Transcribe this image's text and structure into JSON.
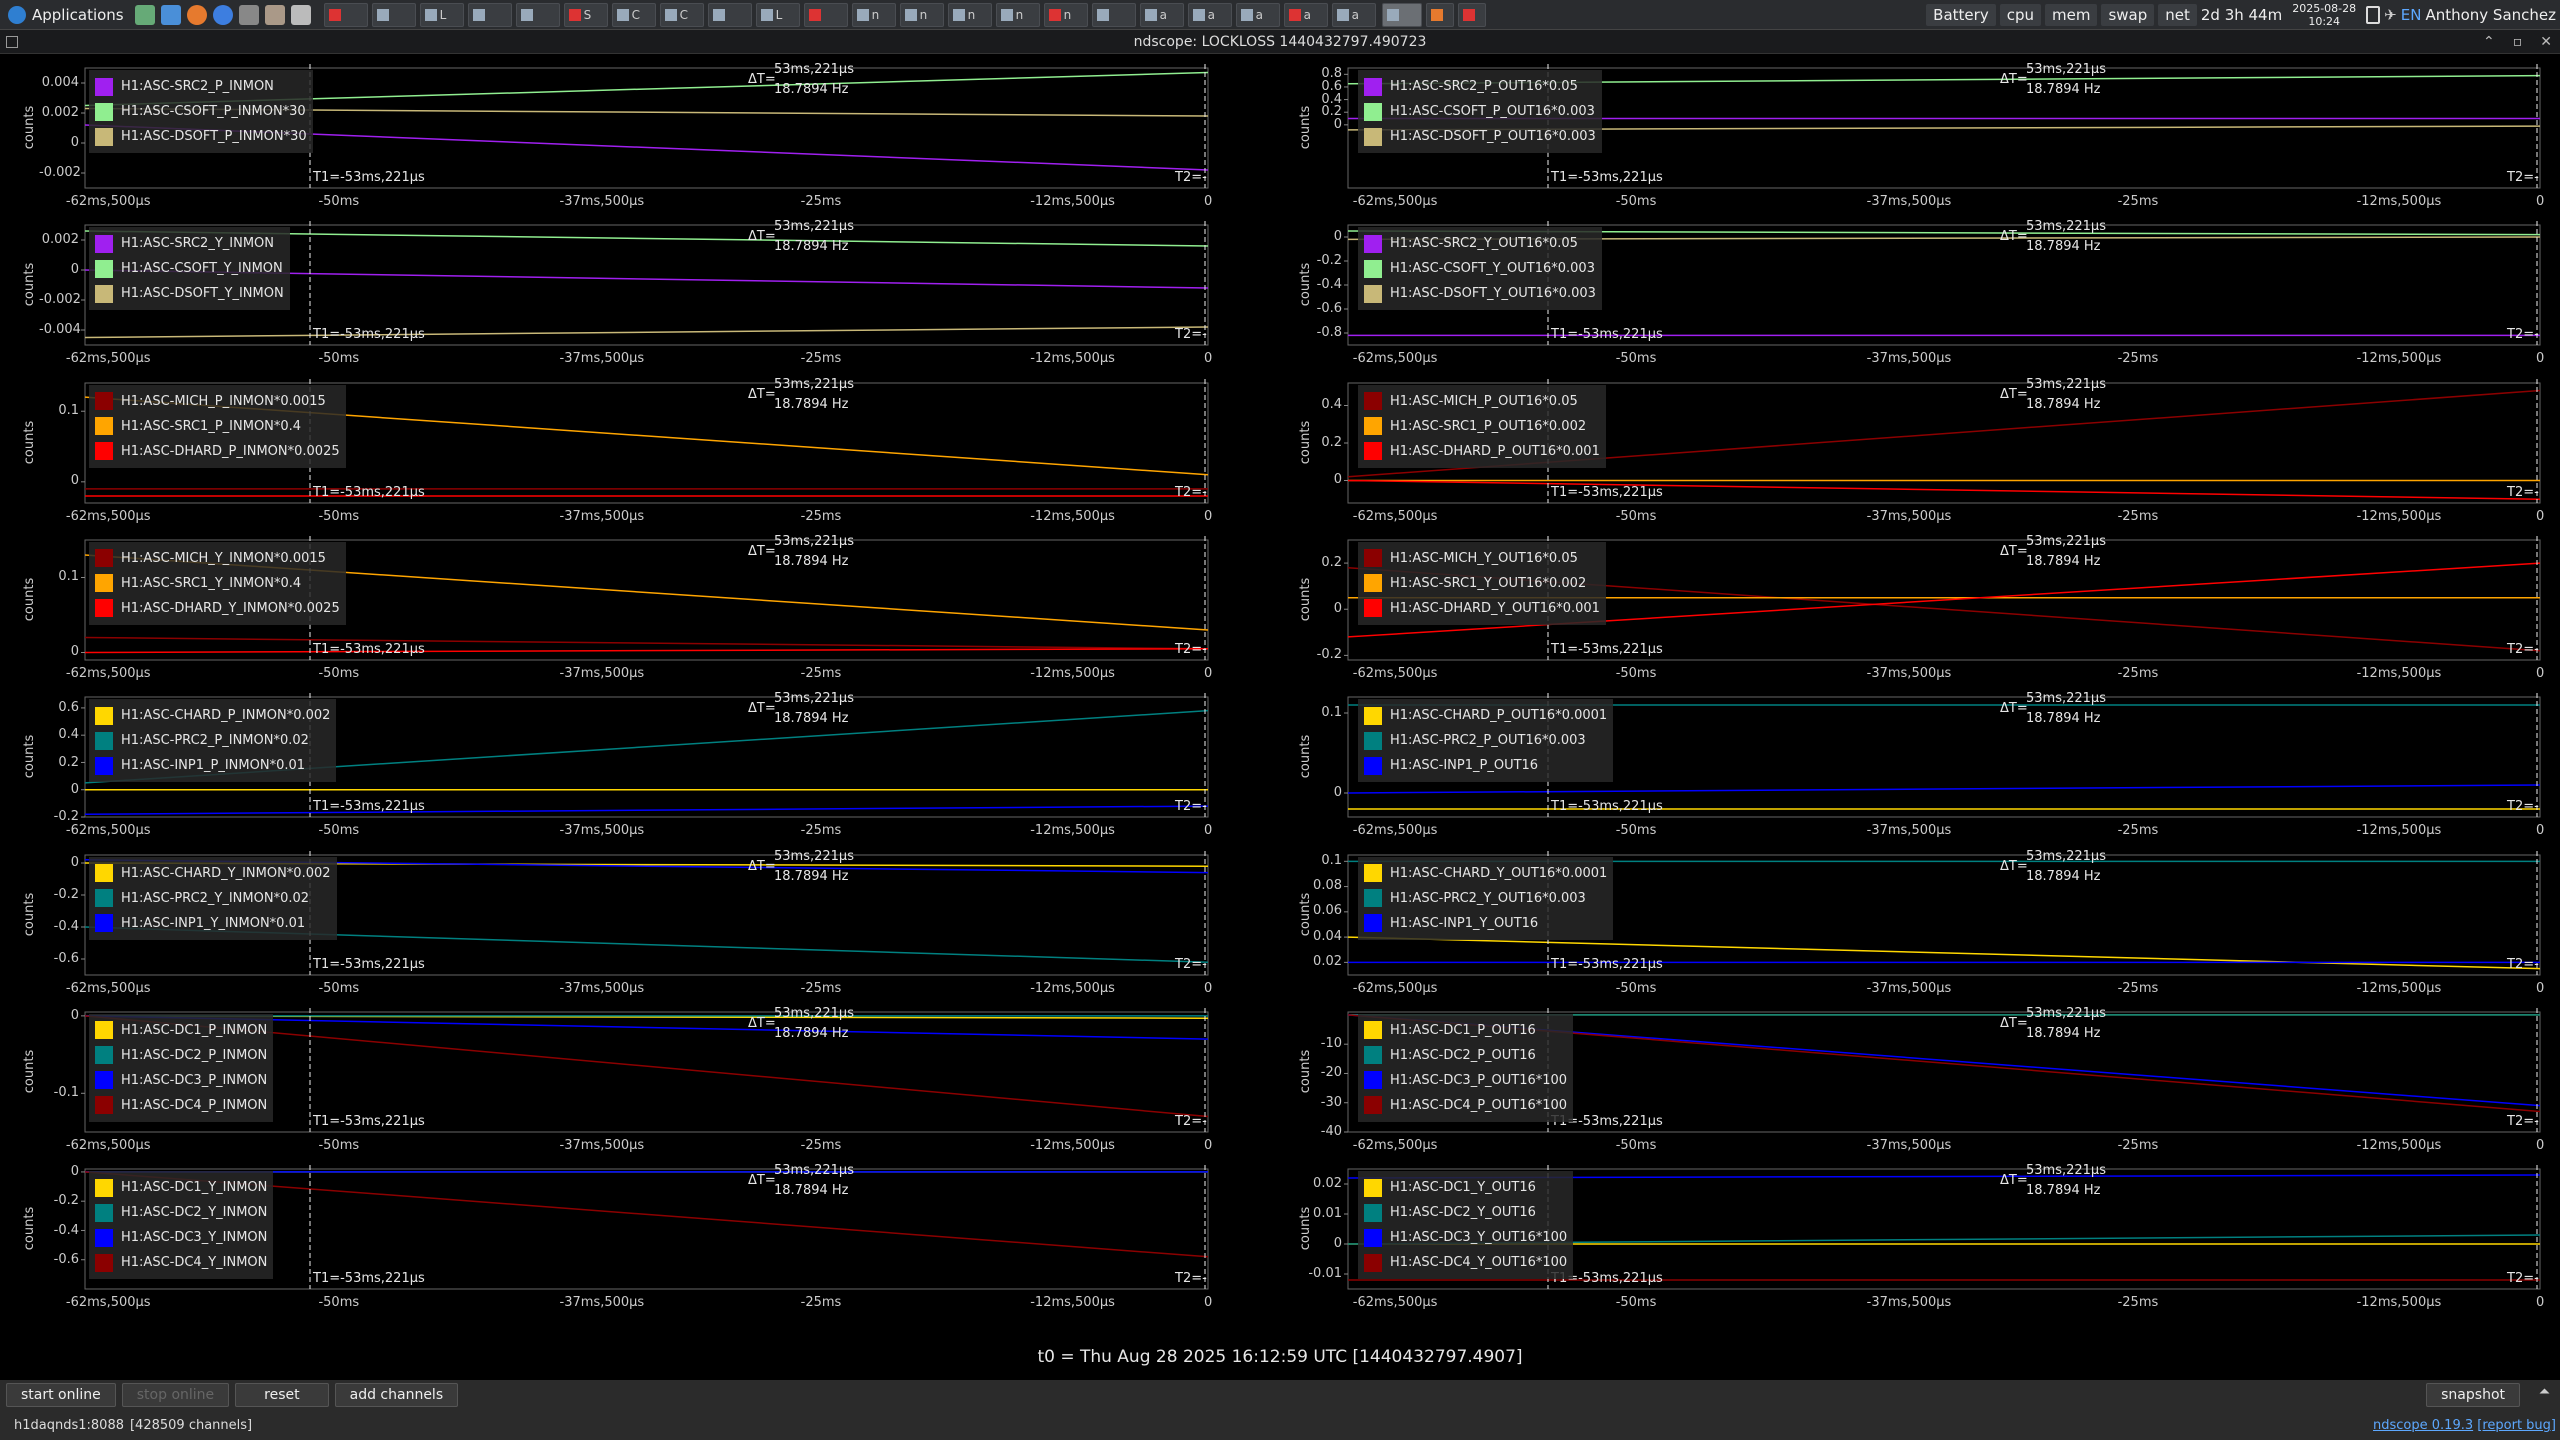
{
  "taskbar": {
    "apps_label": "Applications",
    "tasks": [
      "",
      "",
      "L",
      "",
      "",
      "S",
      "C",
      "C",
      "",
      "L",
      "",
      "n",
      "n",
      "n",
      "n",
      "n",
      "",
      "a",
      "a",
      "a",
      "a",
      "a"
    ],
    "tray": {
      "battery": "Battery",
      "cpu": "cpu",
      "mem": "mem",
      "swap": "swap",
      "net": "net",
      "uptime": "2d 3h 44m",
      "date": "2025-08-28",
      "time": "10:24",
      "lang": "EN",
      "user": "Anthony Sanchez"
    }
  },
  "window": {
    "title": "ndscope: LOCKLOSS 1440432797.490723"
  },
  "common": {
    "y_axis_title": "counts",
    "delta_label": "ΔT=",
    "delta_value": "53ms,221µs",
    "delta_freq": "18.7894 Hz",
    "t1_label": "T1=-53ms,221µs",
    "t2_label": "T2=-",
    "x_ticks": [
      "-62ms,500µs",
      "-50ms",
      "-37ms,500µs",
      "-25ms",
      "-12ms,500µs",
      "0"
    ],
    "x_ticks_right": [
      "-62ms,500µs",
      "-50ms",
      "-37ms,500µs",
      "-25ms",
      "-12ms,500µs",
      "0"
    ]
  },
  "colors": {
    "purple": "#a020f0",
    "lightgreen": "#90ee90",
    "khaki": "#c8b878",
    "darkred": "#8b0000",
    "orange": "#ffa500",
    "red": "#ff0000",
    "gold": "#ffd700",
    "teal": "#008080",
    "blue": "#0000ff"
  },
  "panels": [
    {
      "ylim": [
        -0.003,
        0.005
      ],
      "yticks": [
        "0.004",
        "0.002",
        "0",
        "-0.002"
      ],
      "channels": [
        {
          "name": "H1:ASC-SRC2_P_INMON",
          "color": "#a020f0",
          "y": [
            0.0012,
            -0.0018
          ]
        },
        {
          "name": "H1:ASC-CSOFT_P_INMON*30",
          "color": "#90ee90",
          "y": [
            0.0025,
            0.0047
          ]
        },
        {
          "name": "H1:ASC-DSOFT_P_INMON*30",
          "color": "#c8b878",
          "y": [
            0.0023,
            0.0018
          ]
        }
      ]
    },
    {
      "ylim": [
        -1.0,
        0.9
      ],
      "yticks": [
        "0.8",
        "0.6",
        "0.4",
        "0.2",
        "0"
      ],
      "channels": [
        {
          "name": "H1:ASC-SRC2_P_OUT16*0.05",
          "color": "#a020f0",
          "y": [
            0.1,
            0.1
          ]
        },
        {
          "name": "H1:ASC-CSOFT_P_OUT16*0.003",
          "color": "#90ee90",
          "y": [
            0.65,
            0.78
          ]
        },
        {
          "name": "H1:ASC-DSOFT_P_OUT16*0.003",
          "color": "#c8b878",
          "y": [
            -0.08,
            -0.02
          ]
        }
      ]
    },
    {
      "ylim": [
        -0.005,
        0.003
      ],
      "yticks": [
        "0.002",
        "0",
        "-0.002",
        "-0.004"
      ],
      "channels": [
        {
          "name": "H1:ASC-SRC2_Y_INMON",
          "color": "#a020f0",
          "y": [
            0.0,
            -0.0012
          ]
        },
        {
          "name": "H1:ASC-CSOFT_Y_INMON",
          "color": "#90ee90",
          "y": [
            0.0026,
            0.0016
          ]
        },
        {
          "name": "H1:ASC-DSOFT_Y_INMON",
          "color": "#c8b878",
          "y": [
            -0.0045,
            -0.0038
          ]
        }
      ]
    },
    {
      "ylim": [
        -0.9,
        0.1
      ],
      "yticks": [
        "0",
        "-0.2",
        "-0.4",
        "-0.6",
        "-0.8"
      ],
      "channels": [
        {
          "name": "H1:ASC-SRC2_Y_OUT16*0.05",
          "color": "#a020f0",
          "y": [
            -0.82,
            -0.82
          ]
        },
        {
          "name": "H1:ASC-CSOFT_Y_OUT16*0.003",
          "color": "#90ee90",
          "y": [
            0.05,
            0.02
          ]
        },
        {
          "name": "H1:ASC-DSOFT_Y_OUT16*0.003",
          "color": "#c8b878",
          "y": [
            -0.02,
            0.0
          ]
        }
      ]
    },
    {
      "ylim": [
        -0.03,
        0.14
      ],
      "yticks": [
        "0.1",
        "0"
      ],
      "channels": [
        {
          "name": "H1:ASC-MICH_P_INMON*0.0015",
          "color": "#8b0000",
          "y": [
            -0.01,
            -0.01
          ]
        },
        {
          "name": "H1:ASC-SRC1_P_INMON*0.4",
          "color": "#ffa500",
          "y": [
            0.12,
            0.01
          ]
        },
        {
          "name": "H1:ASC-DHARD_P_INMON*0.0025",
          "color": "#ff0000",
          "y": [
            -0.02,
            -0.02
          ]
        }
      ]
    },
    {
      "ylim": [
        -0.12,
        0.52
      ],
      "yticks": [
        "0.4",
        "0.2",
        "0"
      ],
      "channels": [
        {
          "name": "H1:ASC-MICH_P_OUT16*0.05",
          "color": "#8b0000",
          "y": [
            0.02,
            0.48
          ]
        },
        {
          "name": "H1:ASC-SRC1_P_OUT16*0.002",
          "color": "#ffa500",
          "y": [
            0.0,
            0.0
          ]
        },
        {
          "name": "H1:ASC-DHARD_P_OUT16*0.001",
          "color": "#ff0000",
          "y": [
            0.0,
            -0.1
          ]
        }
      ]
    },
    {
      "ylim": [
        -0.01,
        0.15
      ],
      "yticks": [
        "0.1",
        "0"
      ],
      "channels": [
        {
          "name": "H1:ASC-MICH_Y_INMON*0.0015",
          "color": "#8b0000",
          "y": [
            0.02,
            0.005
          ]
        },
        {
          "name": "H1:ASC-SRC1_Y_INMON*0.4",
          "color": "#ffa500",
          "y": [
            0.13,
            0.03
          ]
        },
        {
          "name": "H1:ASC-DHARD_Y_INMON*0.0025",
          "color": "#ff0000",
          "y": [
            0.0,
            0.005
          ]
        }
      ]
    },
    {
      "ylim": [
        -0.22,
        0.3
      ],
      "yticks": [
        "0.2",
        "0",
        "-0.2"
      ],
      "channels": [
        {
          "name": "H1:ASC-MICH_Y_OUT16*0.05",
          "color": "#8b0000",
          "y": [
            0.18,
            -0.18
          ]
        },
        {
          "name": "H1:ASC-SRC1_Y_OUT16*0.002",
          "color": "#ffa500",
          "y": [
            0.05,
            0.05
          ]
        },
        {
          "name": "H1:ASC-DHARD_Y_OUT16*0.001",
          "color": "#ff0000",
          "y": [
            -0.12,
            0.2
          ]
        }
      ]
    },
    {
      "ylim": [
        -0.2,
        0.68
      ],
      "yticks": [
        "0.6",
        "0.4",
        "0.2",
        "0",
        "-0.2"
      ],
      "channels": [
        {
          "name": "H1:ASC-CHARD_P_INMON*0.002",
          "color": "#ffd700",
          "y": [
            0.0,
            0.0
          ]
        },
        {
          "name": "H1:ASC-PRC2_P_INMON*0.02",
          "color": "#008080",
          "y": [
            0.05,
            0.58
          ]
        },
        {
          "name": "H1:ASC-INP1_P_INMON*0.01",
          "color": "#0000ff",
          "y": [
            -0.18,
            -0.12
          ]
        }
      ]
    },
    {
      "ylim": [
        -0.03,
        0.12
      ],
      "yticks": [
        "0.1",
        "0"
      ],
      "channels": [
        {
          "name": "H1:ASC-CHARD_P_OUT16*0.0001",
          "color": "#ffd700",
          "y": [
            -0.02,
            -0.02
          ]
        },
        {
          "name": "H1:ASC-PRC2_P_OUT16*0.003",
          "color": "#008080",
          "y": [
            0.11,
            0.11
          ]
        },
        {
          "name": "H1:ASC-INP1_P_OUT16",
          "color": "#0000ff",
          "y": [
            0.0,
            0.01
          ]
        }
      ]
    },
    {
      "ylim": [
        -0.7,
        0.05
      ],
      "yticks": [
        "0",
        "-0.2",
        "-0.4",
        "-0.6"
      ],
      "channels": [
        {
          "name": "H1:ASC-CHARD_Y_INMON*0.002",
          "color": "#ffd700",
          "y": [
            0.0,
            -0.02
          ]
        },
        {
          "name": "H1:ASC-PRC2_Y_INMON*0.02",
          "color": "#008080",
          "y": [
            -0.4,
            -0.62
          ]
        },
        {
          "name": "H1:ASC-INP1_Y_INMON*0.01",
          "color": "#0000ff",
          "y": [
            0.02,
            -0.06
          ]
        }
      ]
    },
    {
      "ylim": [
        0.01,
        0.105
      ],
      "yticks": [
        "0.1",
        "0.08",
        "0.06",
        "0.04",
        "0.02"
      ],
      "channels": [
        {
          "name": "H1:ASC-CHARD_Y_OUT16*0.0001",
          "color": "#ffd700",
          "y": [
            0.04,
            0.015
          ]
        },
        {
          "name": "H1:ASC-PRC2_Y_OUT16*0.003",
          "color": "#008080",
          "y": [
            0.1,
            0.1
          ]
        },
        {
          "name": "H1:ASC-INP1_Y_OUT16",
          "color": "#0000ff",
          "y": [
            0.02,
            0.02
          ]
        }
      ]
    },
    {
      "ylim": [
        -0.15,
        0.005
      ],
      "yticks": [
        "0",
        "-0.1"
      ],
      "channels": [
        {
          "name": "H1:ASC-DC1_P_INMON",
          "color": "#ffd700",
          "y": [
            0.0,
            -0.003
          ]
        },
        {
          "name": "H1:ASC-DC2_P_INMON",
          "color": "#008080",
          "y": [
            0.0,
            0.0
          ]
        },
        {
          "name": "H1:ASC-DC3_P_INMON",
          "color": "#0000ff",
          "y": [
            0.0,
            -0.03
          ]
        },
        {
          "name": "H1:ASC-DC4_P_INMON",
          "color": "#8b0000",
          "y": [
            0.0,
            -0.13
          ]
        }
      ]
    },
    {
      "ylim": [
        -40,
        1
      ],
      "yticks": [
        "-10",
        "-20",
        "-30",
        "-40"
      ],
      "channels": [
        {
          "name": "H1:ASC-DC1_P_OUT16",
          "color": "#ffd700",
          "y": [
            0.0,
            0.0
          ]
        },
        {
          "name": "H1:ASC-DC2_P_OUT16",
          "color": "#008080",
          "y": [
            0.0,
            0.0
          ]
        },
        {
          "name": "H1:ASC-DC3_P_OUT16*100",
          "color": "#0000ff",
          "y": [
            0.0,
            -31
          ]
        },
        {
          "name": "H1:ASC-DC4_P_OUT16*100",
          "color": "#8b0000",
          "y": [
            0.0,
            -33
          ]
        }
      ]
    },
    {
      "ylim": [
        -0.8,
        0.02
      ],
      "yticks": [
        "0",
        "-0.2",
        "-0.4",
        "-0.6"
      ],
      "channels": [
        {
          "name": "H1:ASC-DC1_Y_INMON",
          "color": "#ffd700",
          "y": [
            0.0,
            0.0
          ]
        },
        {
          "name": "H1:ASC-DC2_Y_INMON",
          "color": "#008080",
          "y": [
            0.0,
            0.0
          ]
        },
        {
          "name": "H1:ASC-DC3_Y_INMON",
          "color": "#0000ff",
          "y": [
            0.0,
            0.0
          ]
        },
        {
          "name": "H1:ASC-DC4_Y_INMON",
          "color": "#8b0000",
          "y": [
            0.0,
            -0.58
          ]
        }
      ]
    },
    {
      "ylim": [
        -0.015,
        0.025
      ],
      "yticks": [
        "0.02",
        "0.01",
        "0",
        "-0.01"
      ],
      "channels": [
        {
          "name": "H1:ASC-DC1_Y_OUT16",
          "color": "#ffd700",
          "y": [
            0.0,
            0.0
          ]
        },
        {
          "name": "H1:ASC-DC2_Y_OUT16",
          "color": "#008080",
          "y": [
            0.0,
            0.003
          ]
        },
        {
          "name": "H1:ASC-DC3_Y_OUT16*100",
          "color": "#0000ff",
          "y": [
            0.022,
            0.023
          ]
        },
        {
          "name": "H1:ASC-DC4_Y_OUT16*100",
          "color": "#8b0000",
          "y": [
            -0.012,
            -0.012
          ]
        }
      ]
    }
  ],
  "t0_text": "t0 = Thu Aug 28 2025 16:12:59 UTC [1440432797.4907]",
  "buttons": {
    "start_online": "start online",
    "stop_online": "stop online",
    "reset": "reset",
    "add_channels": "add channels",
    "snapshot": "snapshot"
  },
  "status": {
    "server": "h1daqnds1:8088",
    "channels": "[428509 channels]",
    "version": "ndscope 0.19.3",
    "report": "[report bug]"
  }
}
